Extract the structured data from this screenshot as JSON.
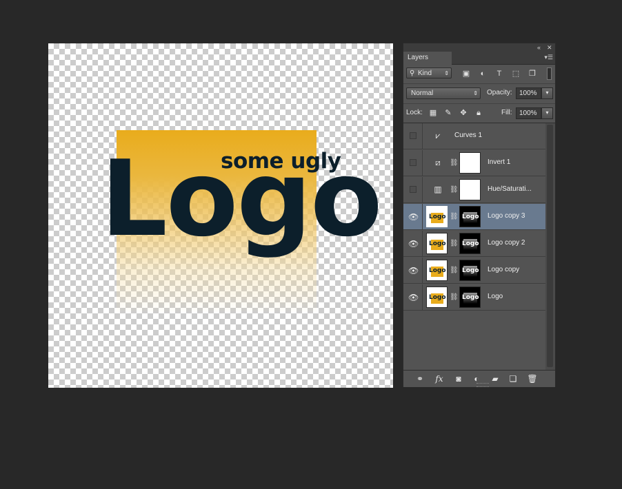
{
  "canvas": {
    "logo_word": "Logo",
    "logo_tagline": "some ugly",
    "colors": {
      "logo_fill": "#e9ac1c",
      "logo_text": "#0c1f2b"
    }
  },
  "panel": {
    "topbar": {
      "collapse_icon": "double-chevron-icon",
      "close_label": "✕"
    },
    "tab_label": "Layers",
    "menu_icon": "panel-menu-icon",
    "filter": {
      "kind_label": "Kind",
      "icons": [
        "image-filter-icon",
        "adjustment-filter-icon",
        "type-filter-icon",
        "shape-filter-icon",
        "smart-object-filter-icon"
      ]
    },
    "blend_mode": "Normal",
    "opacity_label": "Opacity:",
    "opacity_value": "100%",
    "lock_label": "Lock:",
    "fill_label": "Fill:",
    "fill_value": "100%",
    "layers": [
      {
        "name": "Curves 1",
        "visible": false,
        "type": "adjustment",
        "icon": "curves-icon"
      },
      {
        "name": "Invert 1",
        "visible": false,
        "type": "adjustment-mask",
        "icon": "invert-icon"
      },
      {
        "name": "Hue/Saturati...",
        "visible": false,
        "type": "adjustment-mask",
        "icon": "hue-saturation-icon"
      },
      {
        "name": "Logo copy 3",
        "visible": true,
        "type": "masked",
        "selected": true
      },
      {
        "name": "Logo copy 2",
        "visible": true,
        "type": "masked"
      },
      {
        "name": "Logo copy",
        "visible": true,
        "type": "masked"
      },
      {
        "name": "Logo",
        "visible": true,
        "type": "masked"
      }
    ],
    "thumb_text": "Logo",
    "colors": {
      "panel_bg": "#535353",
      "selected_row": "#697a8f"
    }
  }
}
